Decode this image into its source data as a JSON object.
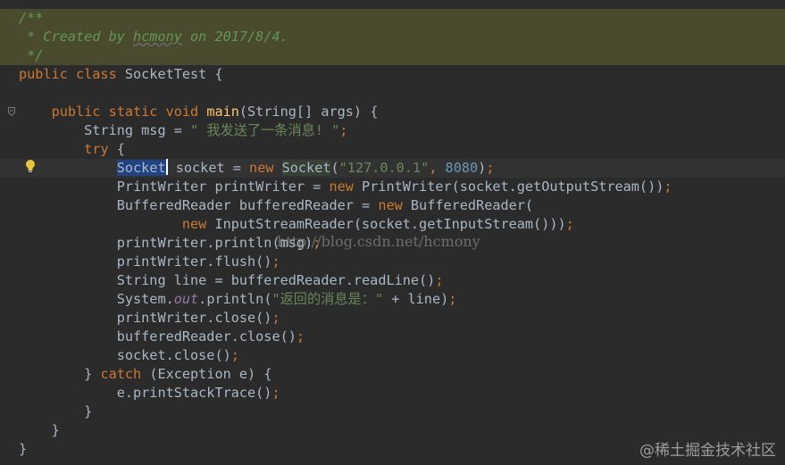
{
  "editor": {
    "theme_colors": {
      "background": "#2b2b2b",
      "keyword": "#cc7832",
      "string": "#6a8759",
      "number": "#6897bb",
      "method": "#ffc66d",
      "doc_comment": "#629755",
      "default_text": "#a9b7c6",
      "field": "#9876aa",
      "selection": "#214283"
    },
    "gutter_icons": [
      "fold-icon",
      "fold-icon",
      "fold-icon",
      "lightbulb-icon"
    ],
    "lines": [
      [
        {
          "t": "/**",
          "c": "doc"
        }
      ],
      [
        {
          "t": " * Created by ",
          "c": "doc"
        },
        {
          "t": "hcmony",
          "c": "doc doc-u"
        },
        {
          "t": " on 2017/8/4.",
          "c": "doc"
        }
      ],
      [
        {
          "t": " */",
          "c": "doc"
        }
      ],
      [
        {
          "t": "public class ",
          "c": "kw"
        },
        {
          "t": "SocketTest {",
          "c": ""
        }
      ],
      [
        {
          "t": "",
          "c": ""
        }
      ],
      [
        {
          "t": "    ",
          "c": ""
        },
        {
          "t": "public static void ",
          "c": "kw"
        },
        {
          "t": "main",
          "c": "fn"
        },
        {
          "t": "(String[] args) {",
          "c": ""
        }
      ],
      [
        {
          "t": "        String msg = ",
          "c": ""
        },
        {
          "t": "\" 我发送了一条消息! \"",
          "c": "str"
        },
        {
          "t": ";",
          "c": "kw"
        }
      ],
      [
        {
          "t": "        ",
          "c": ""
        },
        {
          "t": "try ",
          "c": "kw"
        },
        {
          "t": "{",
          "c": ""
        }
      ],
      [
        {
          "t": "            ",
          "c": ""
        },
        {
          "t": "Socket",
          "c": "sel"
        },
        {
          "t": "",
          "c": "caret"
        },
        {
          "t": " socket = ",
          "c": ""
        },
        {
          "t": "new ",
          "c": "kw"
        },
        {
          "t": "Socket",
          "c": "ref"
        },
        {
          "t": "(",
          "c": ""
        },
        {
          "t": "\"127.0.0.1\"",
          "c": "str"
        },
        {
          "t": ", ",
          "c": "kw"
        },
        {
          "t": "8080",
          "c": "num"
        },
        {
          "t": ")",
          "c": ""
        },
        {
          "t": ";",
          "c": "kw"
        }
      ],
      [
        {
          "t": "            PrintWriter printWriter = ",
          "c": ""
        },
        {
          "t": "new ",
          "c": "kw"
        },
        {
          "t": "PrintWriter(socket.getOutputStream())",
          "c": ""
        },
        {
          "t": ";",
          "c": "kw"
        }
      ],
      [
        {
          "t": "            BufferedReader bufferedReader = ",
          "c": ""
        },
        {
          "t": "new ",
          "c": "kw"
        },
        {
          "t": "BufferedReader(",
          "c": ""
        }
      ],
      [
        {
          "t": "                    ",
          "c": ""
        },
        {
          "t": "new ",
          "c": "kw"
        },
        {
          "t": "InputStreamReader(socket.getInputStream()))",
          "c": ""
        },
        {
          "t": ";",
          "c": "kw"
        }
      ],
      [
        {
          "t": "            printWriter.println(msg)",
          "c": ""
        },
        {
          "t": ";",
          "c": "kw"
        }
      ],
      [
        {
          "t": "            printWriter.flush()",
          "c": ""
        },
        {
          "t": ";",
          "c": "kw"
        }
      ],
      [
        {
          "t": "            String line = bufferedReader.readLine()",
          "c": ""
        },
        {
          "t": ";",
          "c": "kw"
        }
      ],
      [
        {
          "t": "            System.",
          "c": ""
        },
        {
          "t": "out",
          "c": "field"
        },
        {
          "t": ".println(",
          "c": ""
        },
        {
          "t": "\"返回的消息是：\"",
          "c": "str"
        },
        {
          "t": " + line)",
          "c": ""
        },
        {
          "t": ";",
          "c": "kw"
        }
      ],
      [
        {
          "t": "            printWriter.close()",
          "c": ""
        },
        {
          "t": ";",
          "c": "kw"
        }
      ],
      [
        {
          "t": "            bufferedReader.close()",
          "c": ""
        },
        {
          "t": ";",
          "c": "kw"
        }
      ],
      [
        {
          "t": "            socket.close()",
          "c": ""
        },
        {
          "t": ";",
          "c": "kw"
        }
      ],
      [
        {
          "t": "        } ",
          "c": ""
        },
        {
          "t": "catch ",
          "c": "kw"
        },
        {
          "t": "(Exception e) {",
          "c": ""
        }
      ],
      [
        {
          "t": "            e.printStackTrace()",
          "c": ""
        },
        {
          "t": ";",
          "c": "kw"
        }
      ],
      [
        {
          "t": "        }",
          "c": ""
        }
      ],
      [
        {
          "t": "    }",
          "c": ""
        }
      ],
      [
        {
          "t": "}",
          "c": ""
        }
      ]
    ]
  },
  "watermarks": {
    "url": "http://blog.csdn.net/hcmony",
    "site": "@稀土掘金技术社区"
  }
}
